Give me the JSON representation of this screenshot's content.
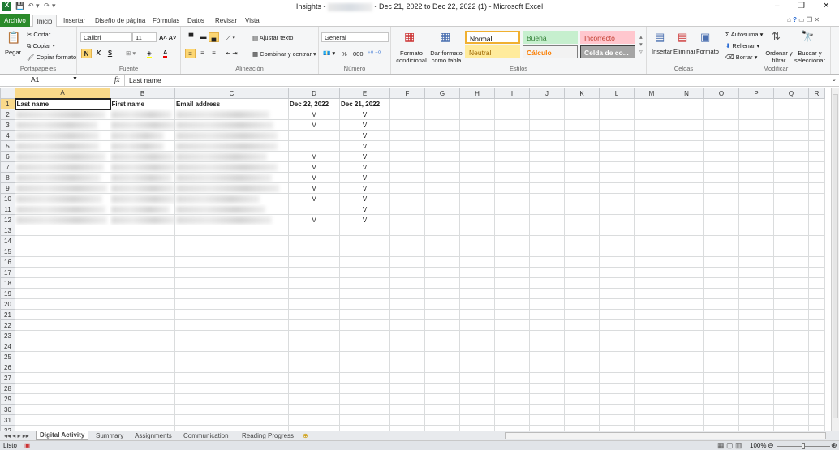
{
  "window": {
    "title_prefix": "Insights -",
    "title_suffix": "- Dec 21, 2022 to Dec 22, 2022 (1) - Microsoft Excel",
    "minimize": "–",
    "restore": "❐",
    "close": "✕"
  },
  "tabs": [
    "Archivo",
    "Inicio",
    "Insertar",
    "Diseño de página",
    "Fórmulas",
    "Datos",
    "Revisar",
    "Vista"
  ],
  "ribbon": {
    "clipboard": {
      "paste": "Pegar",
      "cut": "Cortar",
      "copy": "Copiar",
      "format_painter": "Copiar formato",
      "label": "Portapapeles"
    },
    "font": {
      "name": "Calibri",
      "size": "11",
      "bold": "N",
      "italic": "K",
      "underline": "S",
      "label": "Fuente"
    },
    "alignment": {
      "wrap": "Ajustar texto",
      "merge": "Combinar y centrar",
      "label": "Alineación"
    },
    "number": {
      "format": "General",
      "percent": "%",
      "thousands": "000",
      "label": "Número"
    },
    "styles": {
      "conditional": "Formato condicional",
      "table": "Dar formato como tabla",
      "label": "Estilos",
      "cells": [
        {
          "name": "Normal",
          "bg": "#ffffff",
          "fg": "#000000",
          "border": "#f0b030"
        },
        {
          "name": "Buena",
          "bg": "#c6efce",
          "fg": "#2e7d32",
          "border": "#c6efce"
        },
        {
          "name": "Incorrecto",
          "bg": "#ffc7ce",
          "fg": "#c0392b",
          "border": "#ffc7ce"
        },
        {
          "name": "Neutral",
          "bg": "#ffeb9c",
          "fg": "#9c6500",
          "border": "#ffeb9c"
        },
        {
          "name": "Cálculo",
          "bg": "#f2f2f2",
          "fg": "#fa7d00",
          "border": "#7f7f7f"
        },
        {
          "name": "Celda de co...",
          "bg": "#a5a5a5",
          "fg": "#ffffff",
          "border": "#3f3f3f"
        }
      ]
    },
    "cells": {
      "insert": "Insertar",
      "delete": "Eliminar",
      "format": "Formato",
      "label": "Celdas"
    },
    "editing": {
      "autosum": "Autosuma",
      "fill": "Rellenar",
      "clear": "Borrar",
      "sort": "Ordenar y filtrar",
      "find": "Buscar y seleccionar",
      "label": "Modificar"
    }
  },
  "formula_bar": {
    "cell_ref": "A1",
    "fx": "fx",
    "value": "Last name"
  },
  "columns": [
    "A",
    "B",
    "C",
    "D",
    "E",
    "F",
    "G",
    "H",
    "I",
    "J",
    "K",
    "L",
    "M",
    "N",
    "O",
    "P",
    "Q",
    "R"
  ],
  "headers": [
    "Last name",
    "First name",
    "Email address",
    "Dec 22, 2022",
    "Dec 21, 2022"
  ],
  "col_d": [
    "V",
    "V",
    "",
    "",
    "V",
    "V",
    "V",
    "V",
    "V",
    "",
    "V"
  ],
  "col_e": [
    "V",
    "V",
    "V",
    "V",
    "V",
    "V",
    "V",
    "V",
    "V",
    "V",
    "V"
  ],
  "row_count": 32,
  "sheets": [
    "Digital Activity",
    "Summary",
    "Assignments",
    "Communication",
    "Reading Progress"
  ],
  "active_sheet": "Digital Activity",
  "status": {
    "text": "Listo",
    "zoom": "100%"
  }
}
